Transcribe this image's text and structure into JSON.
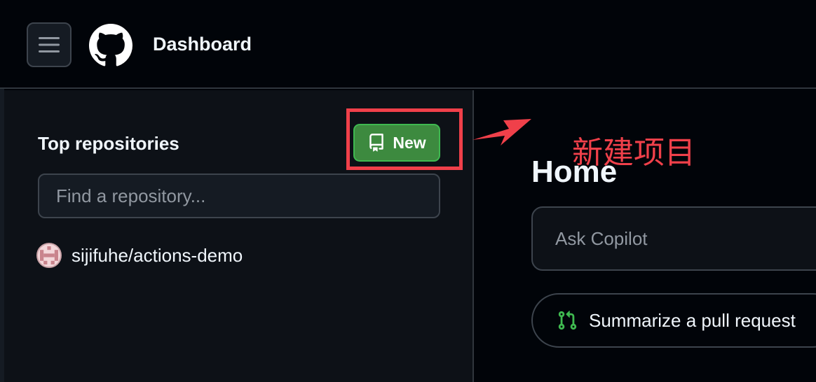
{
  "header": {
    "title": "Dashboard"
  },
  "sidebar": {
    "heading": "Top repositories",
    "new_button_label": "New",
    "search_placeholder": "Find a repository...",
    "repos": [
      {
        "name": "sijifuhe/actions-demo"
      }
    ]
  },
  "main": {
    "heading": "Home",
    "copilot_placeholder": "Ask Copilot",
    "suggestion_label": "Summarize a pull request"
  },
  "annotation": {
    "text": "新建项目",
    "color": "#f0404a"
  },
  "colors": {
    "accent_green": "#3d8a3f",
    "background": "#010409",
    "panel": "#0d1117"
  },
  "icons": [
    "hamburger-icon",
    "github-logo",
    "repo-icon",
    "pull-request-icon"
  ]
}
